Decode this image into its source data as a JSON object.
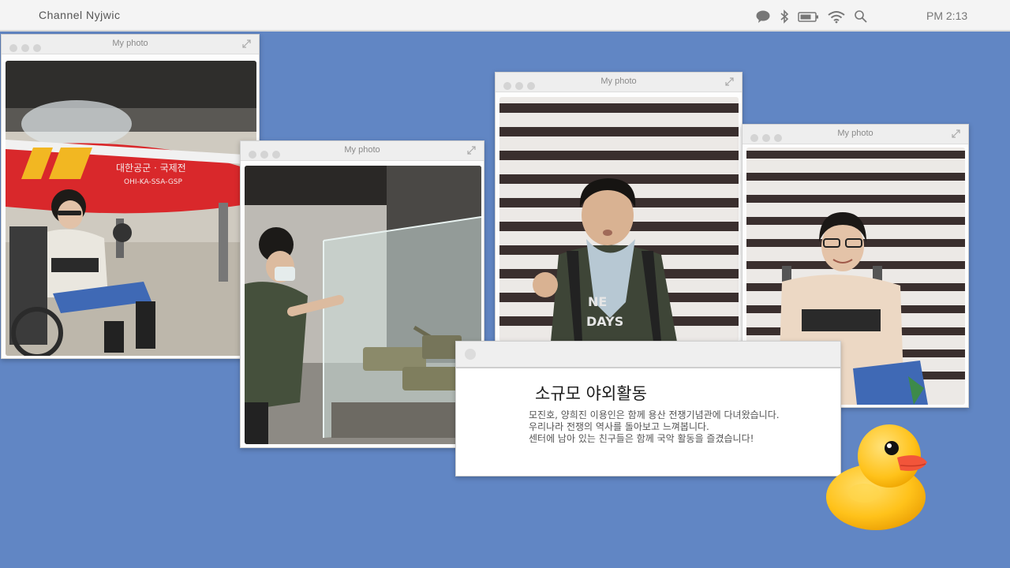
{
  "menubar": {
    "brand": "Channel Nyjwic",
    "clock": "PM  2:13",
    "status_icons": [
      "chat-icon",
      "bluetooth-icon",
      "battery-icon",
      "wifi-icon",
      "search-icon"
    ]
  },
  "windows": [
    {
      "title": "My photo",
      "photo": "boy-with-tank-model-display"
    },
    {
      "title": "My photo",
      "photo": "girl-in-wheelchair-by-jet"
    },
    {
      "title": "My photo",
      "photo": "boy-with-scarf-at-memorial-wall"
    },
    {
      "title": "My photo",
      "photo": "girl-with-glasses-at-memorial-wall"
    }
  ],
  "dialog": {
    "heading": "소규모 야외활동",
    "lines": [
      "모진호, 양희진 이용인은 함께 용산 전쟁기념관에 다녀왔습니다.",
      "우리나라 전쟁의 역사를 돌아보고 느껴봅니다.",
      "센터에 남아 있는 친구들은 함께 국악 활동을 즐겼습니다!"
    ]
  },
  "colors": {
    "desktop": "#6186c4",
    "menubar": "#f4f4f4",
    "jet_red": "#d9282b",
    "duck_yellow": "#ffc21a",
    "duck_beak": "#f2553a"
  },
  "decoration": "rubber-duck-icon"
}
